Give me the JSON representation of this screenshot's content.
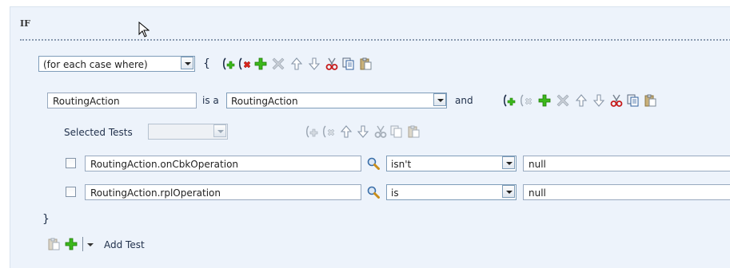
{
  "header": {
    "if_label": "IF"
  },
  "case_row": {
    "scope_value": "(for each case where)",
    "open_brace": "{"
  },
  "routing_row": {
    "variable_value": "RoutingAction",
    "is_a_label": "is a",
    "type_value": "RoutingAction",
    "and_label": "and"
  },
  "selected_tests": {
    "label": "Selected Tests",
    "value": ""
  },
  "tests": [
    {
      "field": "RoutingAction.onCbkOperation",
      "operator": "isn't",
      "value": "null",
      "checked": false
    },
    {
      "field": "RoutingAction.rplOperation",
      "operator": "is",
      "value": "null",
      "checked": false
    }
  ],
  "footer": {
    "close_brace": "}",
    "add_test_label": "Add Test"
  },
  "colors": {
    "panel_bg": "#edf3fb",
    "add_green": "#2ea012",
    "delete_red": "#d8261b",
    "arrow_gray": "#8a98a8"
  }
}
